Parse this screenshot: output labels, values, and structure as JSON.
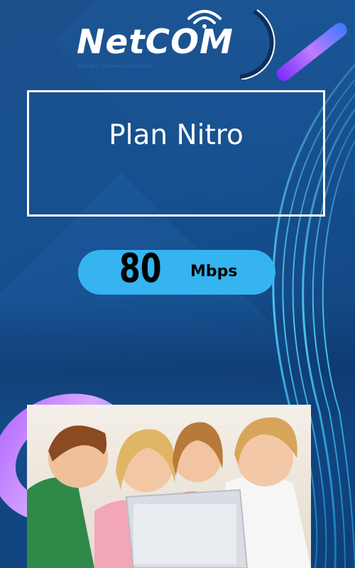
{
  "brand": {
    "logo_text": "NetCOM",
    "tagline": "Internet y Soluciones Informáticas"
  },
  "plan": {
    "title": "Plan Nitro"
  },
  "speed": {
    "value": "80",
    "unit": "Mbps"
  },
  "colors": {
    "background": "#16508f",
    "pill": "#35b4f0",
    "border": "#ffffff"
  },
  "image": {
    "subject": "children-with-laptop"
  }
}
